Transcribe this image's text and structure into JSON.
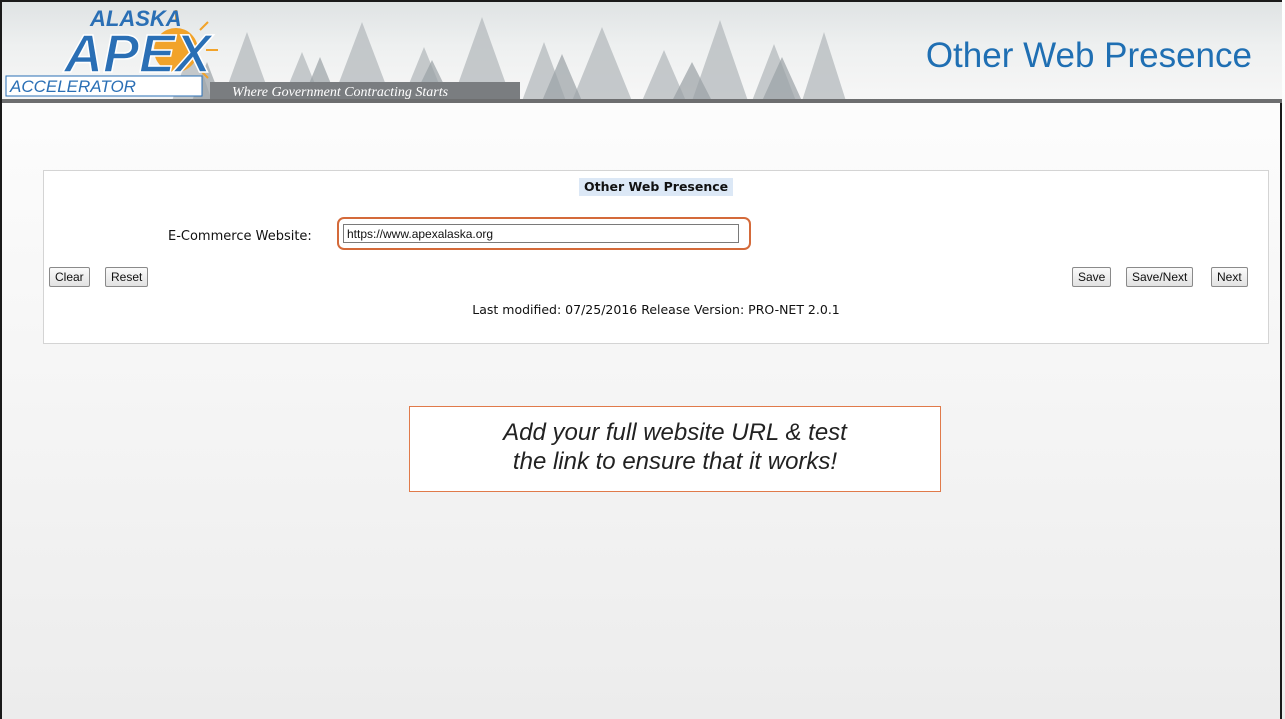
{
  "header": {
    "logo_top": "ALASKA",
    "logo_main": "APEX",
    "logo_bottom": "ACCELERATOR",
    "tagline": "Where Government Contracting Starts",
    "slide_title": "Other Web Presence"
  },
  "form": {
    "heading": "Other Web Presence",
    "ecommerce_label": "E-Commerce Website:",
    "ecommerce_value": "https://www.apexalaska.org",
    "buttons": {
      "clear": "Clear",
      "reset": "Reset",
      "save": "Save",
      "save_next": "Save/Next",
      "next": "Next"
    },
    "last_modified": "Last modified: 07/25/2016 Release Version: PRO-NET 2.0.1"
  },
  "callout": {
    "line1": "Add your full website URL & test",
    "line2": "the link to ensure that it works!"
  },
  "colors": {
    "title_blue": "#1f6fb3",
    "highlight_orange": "#d46a3a",
    "logo_blue": "#2a6fb5"
  }
}
